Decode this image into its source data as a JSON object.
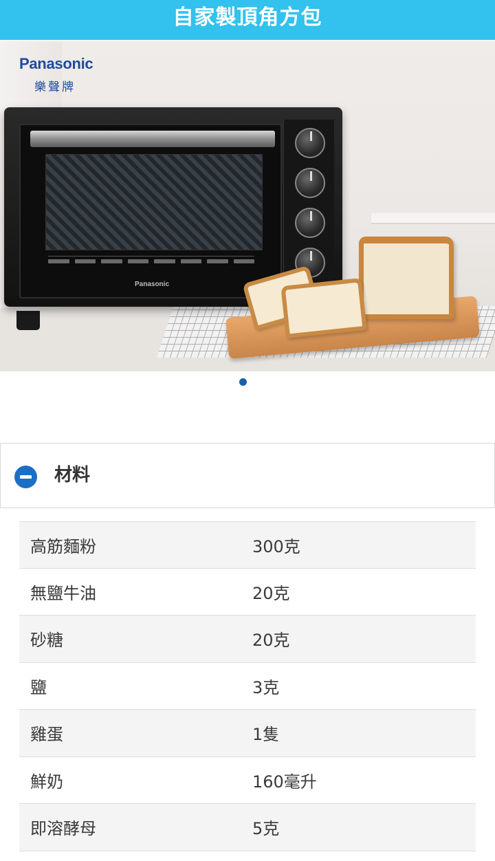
{
  "header": {
    "title": "自家製頂角方包"
  },
  "hero": {
    "brand_name": "Panasonic",
    "brand_sub": "樂聲牌",
    "oven_logo": "Panasonic"
  },
  "carousel": {
    "current": 1,
    "total": 1
  },
  "materials": {
    "title": "材料",
    "expanded": true,
    "items": [
      {
        "name": "高筋麵粉",
        "qty": "300克"
      },
      {
        "name": "無鹽牛油",
        "qty": "20克"
      },
      {
        "name": "砂糖",
        "qty": "20克"
      },
      {
        "name": "鹽",
        "qty": "3克"
      },
      {
        "name": "雞蛋",
        "qty": "1隻"
      },
      {
        "name": "鮮奶",
        "qty": "160毫升"
      },
      {
        "name": "即溶酵母",
        "qty": "5克"
      }
    ]
  },
  "colors": {
    "header_bg": "#33c1ee",
    "accent": "#1c6fc6",
    "dot": "#1c5fa8"
  }
}
